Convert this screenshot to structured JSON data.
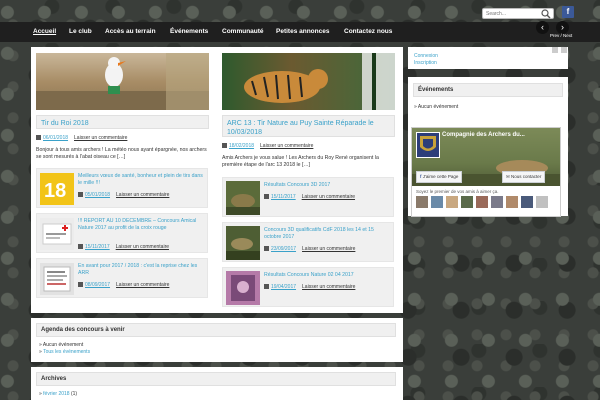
{
  "search": {
    "placeholder": "Search..."
  },
  "facebook_button": {
    "label": "f"
  },
  "nav": {
    "items": [
      "Accueil",
      "Le club",
      "Accès au terrain",
      "Événements",
      "Communauté",
      "Petites annonces",
      "Contactez nous"
    ],
    "active_index": 0
  },
  "slider": {
    "prev": "‹",
    "next": "›",
    "prevnext_text": "Prev / Next"
  },
  "posts": [
    {
      "title": "Tir du Roi 2018",
      "date": "06/01/2018",
      "comment": "Laisser un commentaire",
      "excerpt": "Bonjour à tous amis archers ! La météo nous ayant épargnée, nos archers se sont mesurés à l'abat oiseau ce […]"
    },
    {
      "title": "ARC 13 : Tir Nature au Puy Sainte Réparade le 10/03/2018",
      "date": "18/02/2018",
      "comment": "Laisser un commentaire",
      "excerpt": "Amis Archers je vous salue ! Les Archers du Roy René organisent la première étape de l'arc 13 2018 le […]"
    }
  ],
  "mini_left": [
    {
      "title": "Meilleurs vœux de santé, bonheur et plein de tirs dans le mille !!!",
      "date": "05/01/2018",
      "comment": "Laisser un commentaire"
    },
    {
      "title": "!!! REPORT AU 10 DECEMBRE – Concours Amical Nature 2017 au profit de la croix rouge",
      "date": "15/11/2017",
      "comment": "Laisser un commentaire"
    },
    {
      "title": "En avant pour 2017 / 2018 : c'est la reprise chez les ARR",
      "date": "08/09/2017",
      "comment": "Laisser un commentaire"
    }
  ],
  "mini_right": [
    {
      "title": "Résultats Concours 3D 2017",
      "date": "15/11/2017",
      "comment": "Laisser un commentaire"
    },
    {
      "title": "Concours 3D qualificatifs CdF 2018 les 14 et 15 octobre 2017",
      "date": "23/09/2017",
      "comment": "Laisser un commentaire"
    },
    {
      "title": "Résultats Concours Nature 02 04 2017",
      "date": "19/04/2017",
      "comment": "Laisser un commentaire"
    }
  ],
  "sidebar": {
    "links": [
      "Connexion",
      "Inscription"
    ],
    "events_title": "Événements",
    "events_empty": "Aucun événement",
    "fb_page_name": "Compagnie des Archers du...",
    "fb_like": "J'aime cette Page",
    "fb_contact": "Nous contacter",
    "fb_friends_text": "Soyez le premier de vos amis à aimer ça."
  },
  "agenda": {
    "title": "Agenda des concours à venir",
    "empty": "Aucun événement",
    "all": "Tous les événements"
  },
  "archives": {
    "title": "Archives",
    "first_item": "février 2018",
    "first_count": "(1)"
  },
  "colors": {
    "link": "#3aa1c9",
    "nav_bg": "#1f1f1f",
    "facebook": "#3b5998"
  }
}
